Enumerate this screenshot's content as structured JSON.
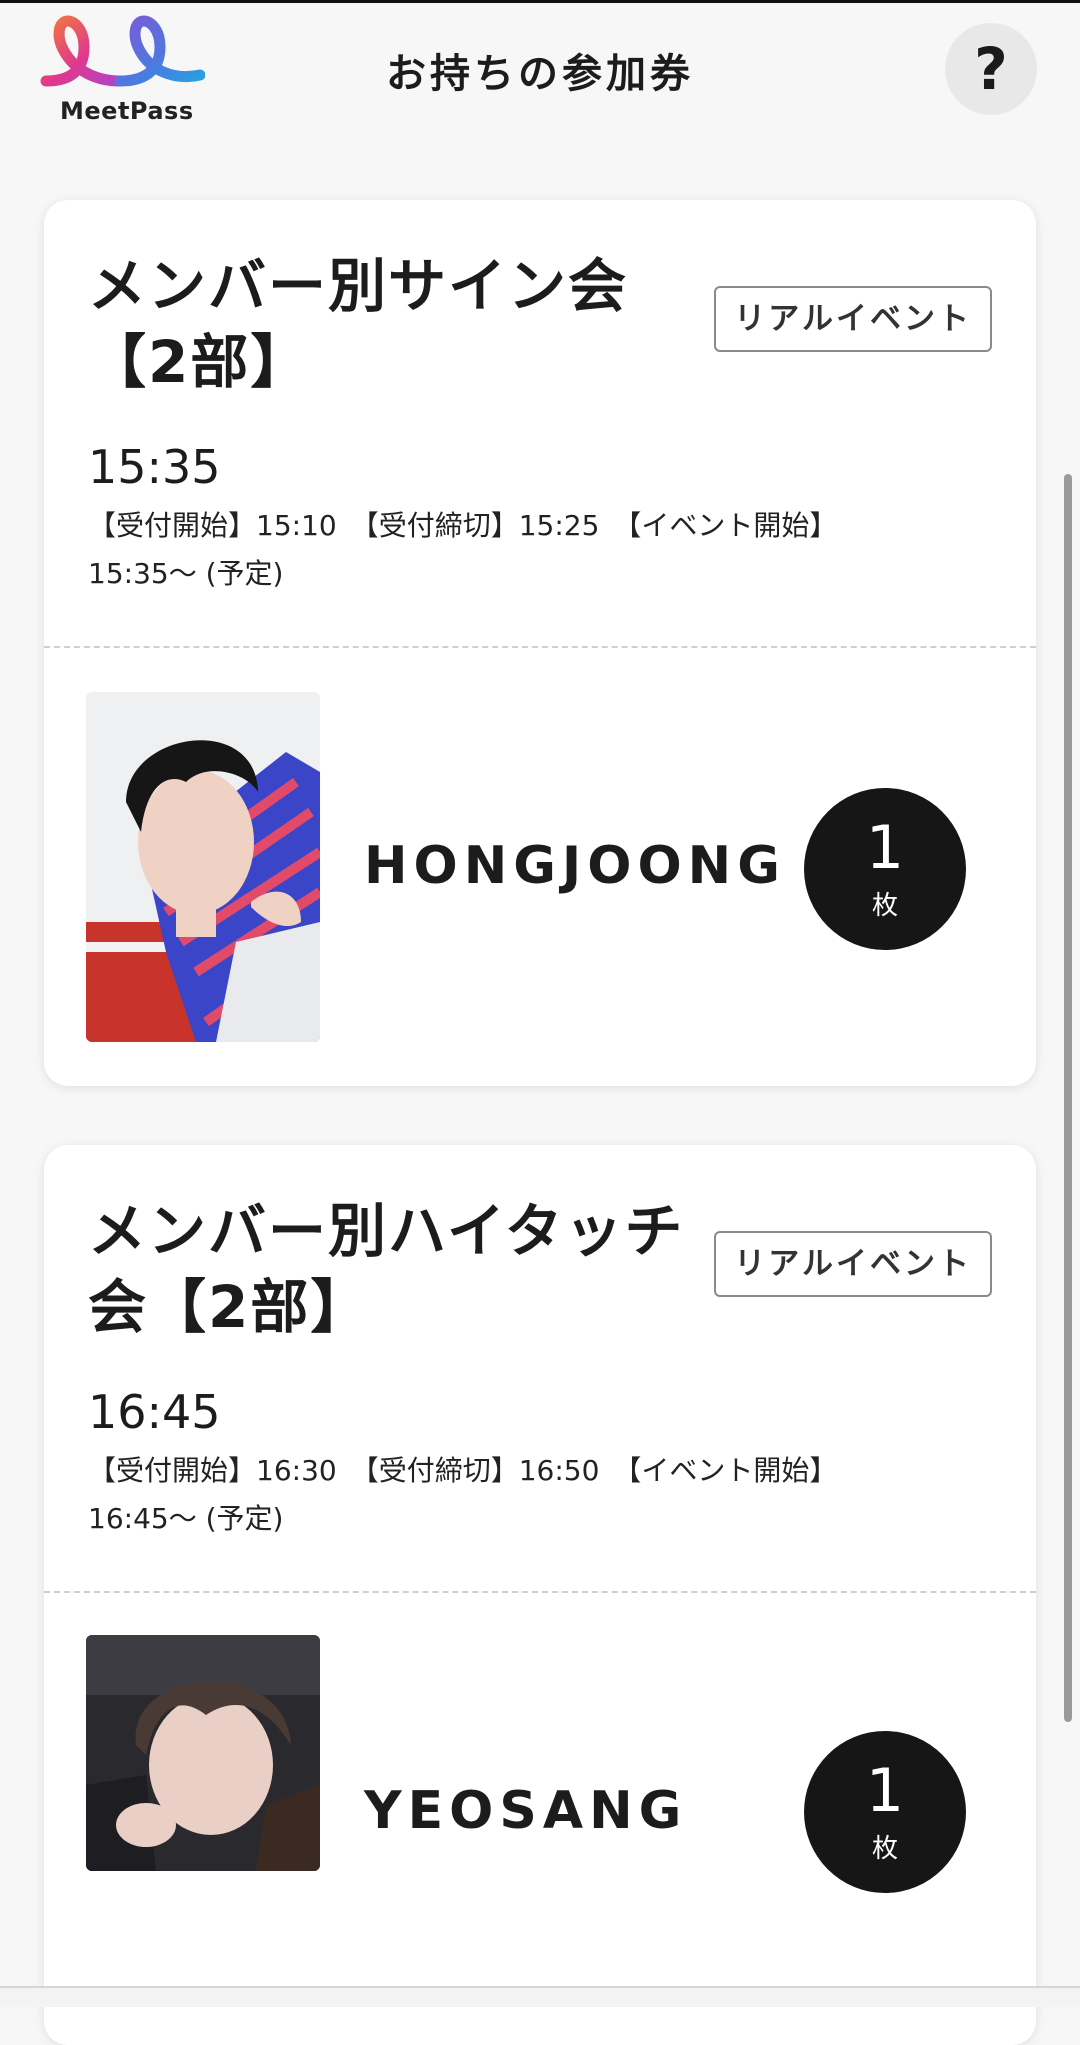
{
  "header": {
    "logo_text": "MeetPass",
    "title": "お持ちの参加券",
    "help_label": "?"
  },
  "tickets": [
    {
      "title_line1": "メンバー別サイン会",
      "title_line2": "【2部】",
      "badge": "リアルイベント",
      "time": "15:35",
      "detail_line1": "【受付開始】15:10　【受付締切】15:25　【イベント開始】",
      "detail_line2": "15:35〜 (予定)",
      "member": "HONGJOONG",
      "count": "1",
      "count_unit": "枚"
    },
    {
      "title_line1": "メンバー別ハイタッチ",
      "title_line2": "会【2部】",
      "badge": "リアルイベント",
      "time": "16:45",
      "detail_line1": "【受付開始】16:30　【受付締切】16:50　【イベント開始】",
      "detail_line2": "16:45〜 (予定)",
      "member": "YEOSANG",
      "count": "1",
      "count_unit": "枚"
    }
  ],
  "colors": {
    "count_circle": "#161616",
    "logo_pink": "#e0388f",
    "logo_blue": "#2aa0e0",
    "logo_orange": "#f07a3a",
    "logo_purple": "#7b5bd6"
  }
}
